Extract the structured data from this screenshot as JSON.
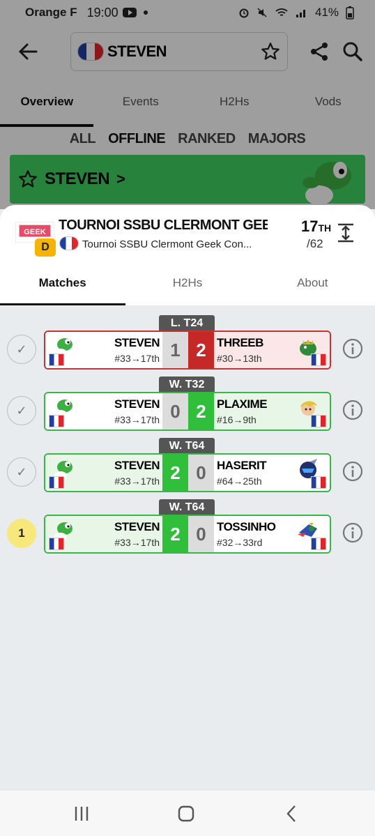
{
  "status_bar": {
    "carrier": "Orange F",
    "time": "19:00",
    "battery": "41%"
  },
  "appbar": {
    "search_name": "STEVEN"
  },
  "top_tabs": [
    "Overview",
    "Events",
    "H2Hs",
    "Vods"
  ],
  "filters": [
    "ALL",
    "OFFLINE",
    "RANKED",
    "MAJORS"
  ],
  "player_banner": {
    "name": "STEVEN",
    "chevron": ">"
  },
  "tournament": {
    "title": "TOURNOI SSBU CLERMONT GEEK CON...",
    "subtitle": "Tournoi SSBU Clermont Geek Con...",
    "tier": "D",
    "placing": "17",
    "placing_suffix": "TH",
    "total": "/62",
    "logo_text": "GEEK"
  },
  "sheet_tabs": [
    "Matches",
    "H2Hs",
    "About"
  ],
  "matches": [
    {
      "round": "L. T24",
      "status": "✓",
      "result": "lose",
      "p1": {
        "name": "STEVEN",
        "seed": "#33→17th"
      },
      "p2": {
        "name": "THREEB",
        "seed": "#30→13th"
      },
      "s1": "1",
      "s2": "2"
    },
    {
      "round": "W. T32",
      "status": "✓",
      "result": "lose",
      "p1": {
        "name": "STEVEN",
        "seed": "#33→17th"
      },
      "p2": {
        "name": "PLAXIME",
        "seed": "#16→9th"
      },
      "s1": "0",
      "s2": "2"
    },
    {
      "round": "W. T64",
      "status": "✓",
      "result": "win",
      "p1": {
        "name": "STEVEN",
        "seed": "#33→17th"
      },
      "p2": {
        "name": "HASERIT",
        "seed": "#64→25th"
      },
      "s1": "2",
      "s2": "0"
    },
    {
      "round": "W. T64",
      "status": "1",
      "result": "win",
      "p1": {
        "name": "STEVEN",
        "seed": "#33→17th"
      },
      "p2": {
        "name": "TOSSINHO",
        "seed": "#32→33rd"
      },
      "s1": "2",
      "s2": "0"
    }
  ],
  "colors": {
    "banner_green": "#3fd461",
    "win_green": "#2fbf3a",
    "lose_red": "#c62828",
    "tier_yellow": "#f4b400"
  }
}
